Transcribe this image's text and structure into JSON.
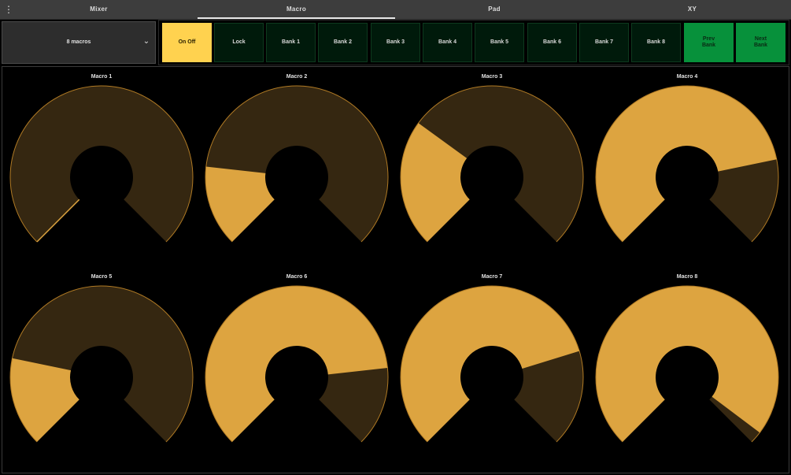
{
  "tabs": {
    "menu_icon": "⋮",
    "items": [
      {
        "label": "Mixer",
        "active": false
      },
      {
        "label": "Macro",
        "active": true
      },
      {
        "label": "Pad",
        "active": false
      },
      {
        "label": "XY",
        "active": false
      }
    ]
  },
  "toolbar": {
    "macro_select": {
      "value": "8 macros",
      "icon": "chevron-down-icon"
    },
    "buttons": [
      {
        "label": "On Off",
        "style": "onoff"
      },
      {
        "label": "Lock",
        "style": "dark"
      },
      {
        "label": "Bank 1",
        "style": "dark"
      },
      {
        "label": "Bank 2",
        "style": "dark"
      },
      {
        "label": "Bank 3",
        "style": "dark"
      },
      {
        "label": "Bank 4",
        "style": "dark"
      },
      {
        "label": "Bank 5",
        "style": "dark"
      },
      {
        "label": "Bank 6",
        "style": "dark"
      },
      {
        "label": "Bank 7",
        "style": "dark"
      },
      {
        "label": "Bank 8",
        "style": "dark"
      },
      {
        "label": "Prev\nBank",
        "style": "green"
      },
      {
        "label": "Next\nBank",
        "style": "green"
      }
    ]
  },
  "macros": [
    {
      "label": "Macro 1",
      "value": 0.0
    },
    {
      "label": "Macro 2",
      "value": 0.19
    },
    {
      "label": "Macro 3",
      "value": 0.3
    },
    {
      "label": "Macro 4",
      "value": 0.79
    },
    {
      "label": "Macro 5",
      "value": 0.21
    },
    {
      "label": "Macro 6",
      "value": 0.81
    },
    {
      "label": "Macro 7",
      "value": 0.77
    },
    {
      "label": "Macro 8",
      "value": 0.97
    }
  ],
  "colors": {
    "fill": "#dda440",
    "track": "#352711",
    "outline": "#b07a24",
    "onoff": "#ffd24f",
    "bank_green": "#07913b",
    "bank_dark": "#001a0b"
  }
}
